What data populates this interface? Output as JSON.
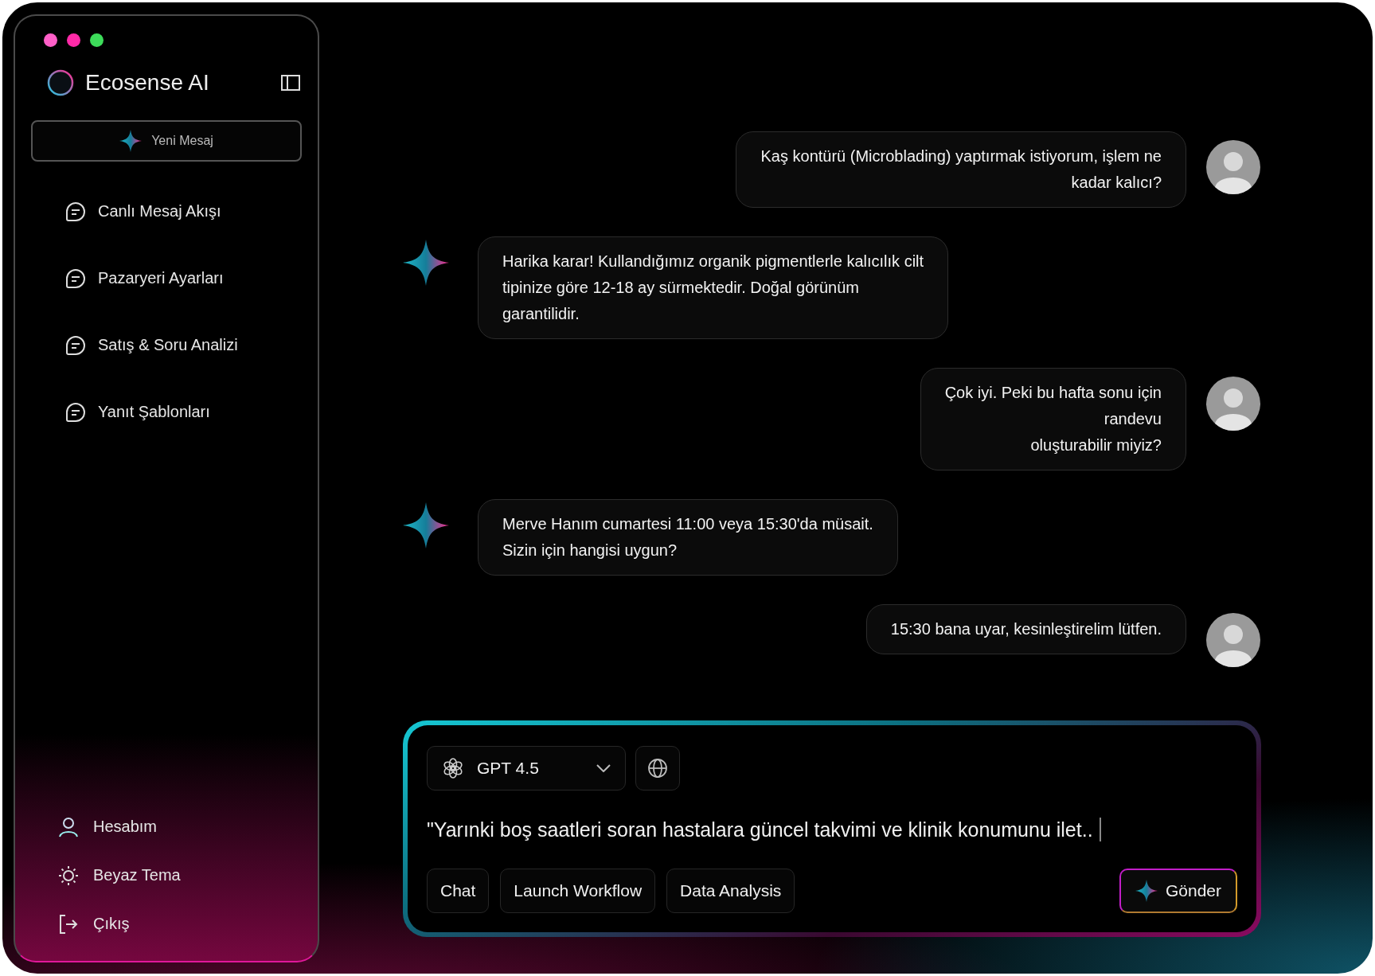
{
  "app": {
    "title": "Ecosense AI",
    "new_message": "Yeni Mesaj"
  },
  "sidebar": {
    "items": [
      {
        "label": "Canlı Mesaj Akışı"
      },
      {
        "label": "Pazaryeri Ayarları"
      },
      {
        "label": "Satış & Soru Analizi"
      },
      {
        "label": "Yanıt Şablonları"
      }
    ],
    "footer": [
      {
        "kind": "account",
        "label": "Hesabım"
      },
      {
        "kind": "theme",
        "label": "Beyaz Tema"
      },
      {
        "kind": "logout",
        "label": "Çıkış"
      }
    ]
  },
  "messages": [
    {
      "kind": "user",
      "text": "Kaş kontürü (Microblading) yaptırmak istiyorum, işlem ne\nkadar kalıcı?"
    },
    {
      "kind": "bot",
      "text": "Harika karar! Kullandığımız organik pigmentlerle kalıcılık cilt\ntipinize göre 12-18 ay sürmektedir. Doğal görünüm\ngarantilidir."
    },
    {
      "kind": "user",
      "text": "Çok iyi. Peki bu hafta sonu için\nrandevu\noluşturabilir miyiz?"
    },
    {
      "kind": "bot",
      "text": "Merve Hanım cumartesi 11:00 veya 15:30'da müsait.\nSizin için hangisi uygun?"
    },
    {
      "kind": "user",
      "text": "15:30 bana uyar, kesinleştirelim lütfen."
    }
  ],
  "composer": {
    "model": "GPT 4.5",
    "value": "\"Yarınki boş saatleri soran hastalara güncel takvimi ve klinik konumunu ilet..",
    "actions": [
      "Chat",
      "Launch Workflow",
      "Data Analysis"
    ],
    "send": "Gönder"
  }
}
